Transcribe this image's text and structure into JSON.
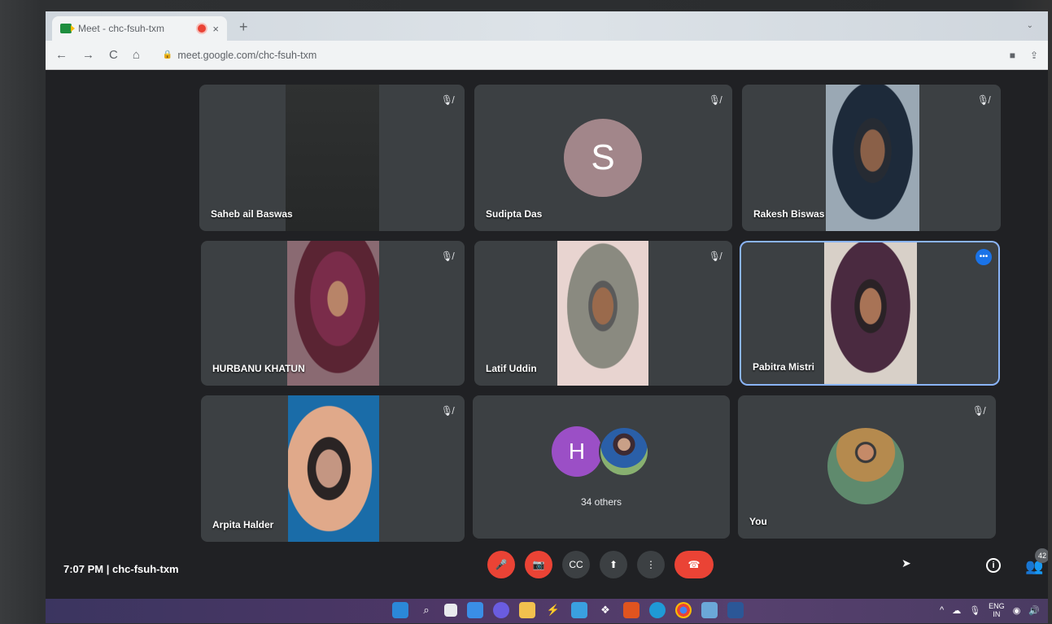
{
  "browser": {
    "tab_title": "Meet - chc-fsuh-txm",
    "tab_close": "×",
    "new_tab": "+",
    "tab_menu": "⌄",
    "url": "meet.google.com/chc-fsuh-txm",
    "back": "←",
    "forward": "→",
    "reload": "C",
    "home": "⌂",
    "lock": "🔒",
    "camera": "■",
    "share": "⇪"
  },
  "participants": [
    {
      "name": "Saheb ail Baswas",
      "muted": true
    },
    {
      "name": "Sudipta Das",
      "muted": true,
      "initial": "S"
    },
    {
      "name": "Rakesh Biswas",
      "muted": true
    },
    {
      "name": "HURBANU KHATUN",
      "muted": true
    },
    {
      "name": "Latif Uddin",
      "muted": true
    },
    {
      "name": "Pabitra Mistri",
      "muted": false,
      "active": true
    },
    {
      "name": "Arpita Halder",
      "muted": true
    },
    {
      "name": "34 others",
      "initial": "H"
    },
    {
      "name": "You",
      "muted": true
    }
  ],
  "icons": {
    "mic_off": "🎙︎̸",
    "more": "•••"
  },
  "meeting": {
    "time_code": "7:07 PM  |  chc-fsuh-txm",
    "people_count": "42"
  },
  "controls": {
    "mic": "🎤",
    "cam": "📷",
    "cc": "CC",
    "present": "⬆",
    "more": "⋮",
    "end": "☎"
  },
  "taskbar": {
    "lang_top": "ENG",
    "lang_bottom": "IN",
    "tray_arrow": "^"
  },
  "colors": {
    "meet_bg": "#202124",
    "tile_bg": "#3c4043",
    "accent": "#8ab4f8",
    "end_call": "#ea4335"
  }
}
